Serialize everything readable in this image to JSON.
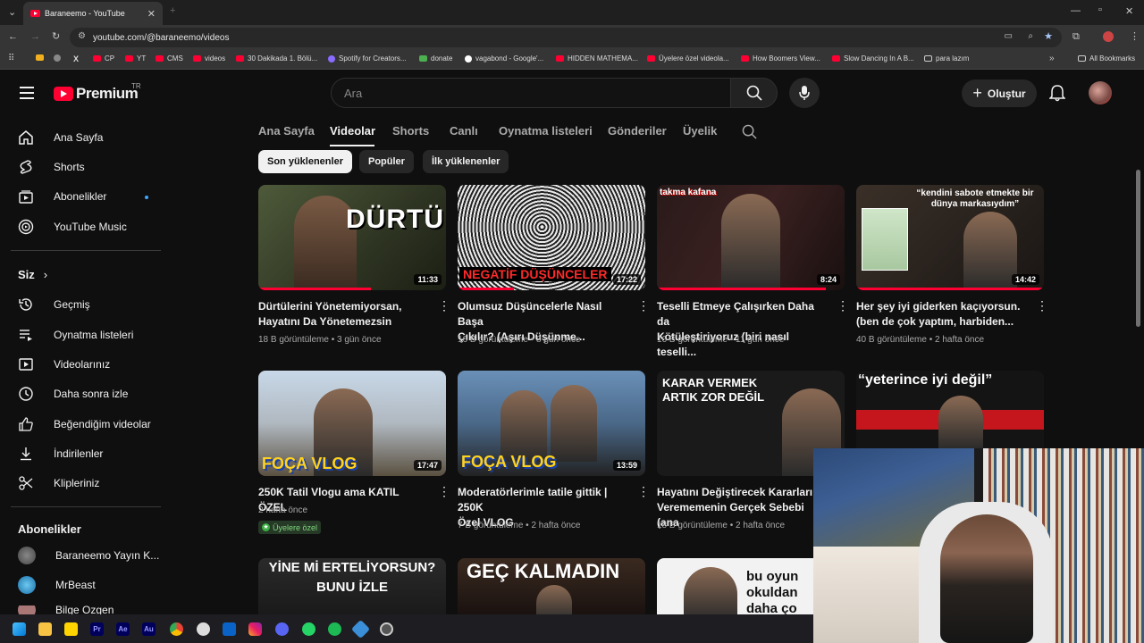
{
  "browser": {
    "tab_title": "Baraneemo - YouTube",
    "url": "youtube.com/@baraneemo/videos",
    "bookmarks": [
      "CP",
      "YT",
      "CMS",
      "videos",
      "30 Dakikada 1. Bölü...",
      "Spotify for Creators...",
      "donate",
      "vagabond - Google'...",
      "HIDDEN MATHEMA...",
      "Üyelere özel videola...",
      "How Boomers View...",
      "Slow Dancing In A B...",
      "para lazım",
      "All Bookmarks"
    ]
  },
  "header": {
    "logo_text": "Premium",
    "country": "TR",
    "search_placeholder": "Ara",
    "create_label": "Oluştur"
  },
  "sidebar": {
    "main": [
      "Ana Sayfa",
      "Shorts",
      "Abonelikler",
      "YouTube Music"
    ],
    "you_header": "Siz",
    "you_items": [
      "Geçmiş",
      "Oynatma listeleri",
      "Videolarınız",
      "Daha sonra izle",
      "Beğendiğim videolar",
      "İndirilenler",
      "Klipleriniz"
    ],
    "subs_header": "Abonelikler",
    "subs": [
      "Baraneemo Yayın K...",
      "MrBeast",
      "Bilge Özgen"
    ]
  },
  "channel_tabs": [
    "Ana Sayfa",
    "Videolar",
    "Shorts",
    "Canlı",
    "Oynatma listeleri",
    "Gönderiler",
    "Üyelik"
  ],
  "chips": [
    "Son yüklenenler",
    "Popüler",
    "İlk yüklenenler"
  ],
  "videos": [
    {
      "title1": "Dürtülerini Yönetemiyorsan,",
      "title2": "Hayatını Da Yönetemezsin",
      "views": "18 B görüntüleme",
      "age": "3 gün önce",
      "duration": "11:33",
      "thumb_text": "DÜRTÜ!",
      "progress": 0.6
    },
    {
      "title1": "Olumsuz Düşüncelerle Nasıl Başa",
      "title2": "Çıkılır? (Aşırı Düşünme...",
      "views": "16 B görüntüleme",
      "age": "8 gün önce",
      "duration": "17:22",
      "thumb_text": "NEGATİF DÜŞÜNCELER",
      "progress": 0.3
    },
    {
      "title1": "Teselli Etmeye Çalışırken Daha da",
      "title2": "Kötüleştiriyoruz (biri nasıl teselli...",
      "views": "16 B görüntüleme",
      "age": "11 gün önce",
      "duration": "8:24",
      "thumb_text": "takma kafana",
      "progress": 0.9
    },
    {
      "title1": "Her şey iyi giderken kaçıyorsun.",
      "title2": "(ben de çok yaptım, harbiden...",
      "views": "40 B görüntüleme",
      "age": "2 hafta önce",
      "duration": "14:42",
      "thumb_text": "“kendini sabote etmekte bir dünya markasıydım”",
      "progress": 1
    },
    {
      "title1": "250K Tatil Vlogu ama KATIL ÖZEL",
      "title2": "",
      "views": "",
      "age": "2 hafta önce",
      "duration": "17:47",
      "thumb_text": "FOÇA VLOG",
      "members": "Üyelere özel",
      "progress": 0
    },
    {
      "title1": "Moderatörlerimle tatile gittik | 250K",
      "title2": "Özel VLOG",
      "views": "7 B görüntüleme",
      "age": "2 hafta önce",
      "duration": "13:59",
      "thumb_text": "FOÇA VLOG",
      "progress": 0
    },
    {
      "title1": "Hayatını Değiştirecek Kararları",
      "title2": "Verememenin Gerçek Sebebi (ana",
      "views": "18 B görüntüleme",
      "age": "2 hafta önce",
      "duration": "",
      "thumb_text": "KARAR VERMEK ARTIK ZOR DEĞİL",
      "progress": 0
    },
    {
      "title1": "",
      "title2": "",
      "views": "",
      "age": "",
      "duration": "",
      "thumb_text": "“yeterince iyi değil”",
      "progress": 0
    },
    {
      "thumb_text": "YİNE Mİ ERTELİYORSUN? BUNU İZLE"
    },
    {
      "thumb_text": "GEÇ KALMADIN"
    },
    {
      "thumb_text": "bu oyun okuldan daha ço"
    }
  ],
  "colors": {
    "accent": "#ff0033",
    "bg": "#0f0f0f",
    "chip": "#272727",
    "link_blue": "#3ea6ff"
  }
}
